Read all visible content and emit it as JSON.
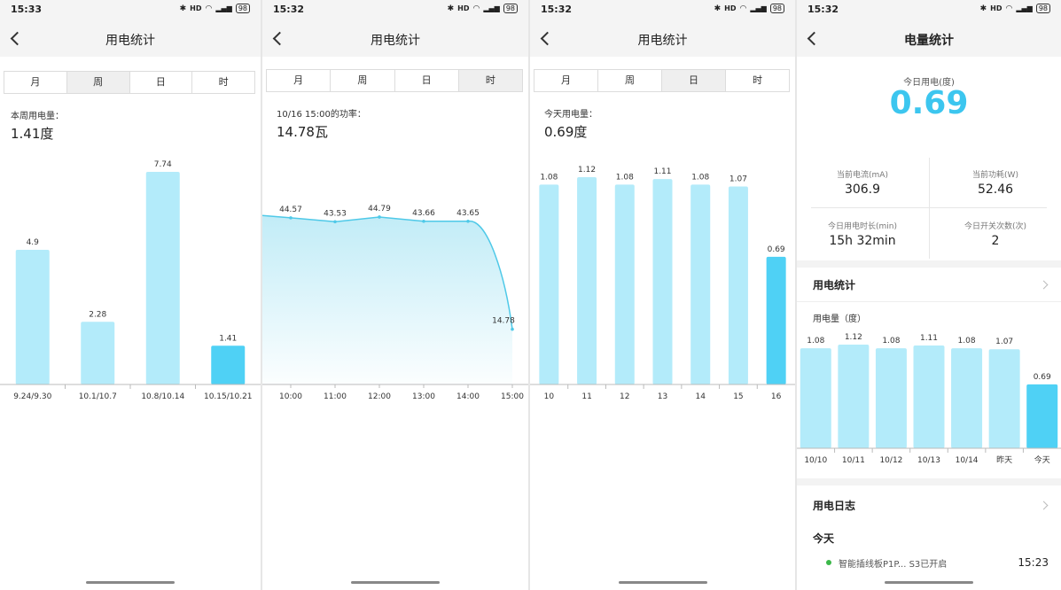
{
  "status": {
    "s1_time": "15:33",
    "s2_time": "15:32",
    "s3_time": "15:32",
    "s4_time": "15:32",
    "battery": "98",
    "icons": [
      "bluetooth-icon",
      "hd-icon",
      "wifi-icon",
      "signal-icon",
      "battery-icon"
    ]
  },
  "tabs": [
    "月",
    "周",
    "日",
    "时"
  ],
  "colors": {
    "bar": "#b3ebfa",
    "bar_active": "#4fd1f5",
    "line": "#4fc9e8",
    "accent": "#3cc6ef",
    "dot_on": "#3cb84a"
  },
  "screen1": {
    "title": "用电统计",
    "active_tab": 1,
    "summary_label": "本周用电量：",
    "summary_value": "1.41度",
    "chart_data": {
      "type": "bar",
      "categories": [
        "9.24/9.30",
        "10.1/10.7",
        "10.8/10.14",
        "10.15/10.21"
      ],
      "values": [
        4.9,
        2.28,
        7.74,
        1.41
      ],
      "labels": [
        "4.9",
        "2.28",
        "7.74",
        "1.41"
      ],
      "highlight_index": 3
    }
  },
  "screen2": {
    "title": "用电统计",
    "active_tab": 3,
    "summary_label": "10/16 15:00的功率：",
    "summary_value": "14.78瓦",
    "chart_data": {
      "type": "area",
      "categories": [
        "10:00",
        "11:00",
        "12:00",
        "13:00",
        "14:00",
        "15:00"
      ],
      "values": [
        44.57,
        43.53,
        44.79,
        43.66,
        43.65,
        14.78
      ],
      "labels": [
        "44.57",
        "43.53",
        "44.79",
        "43.66",
        "43.65",
        "14.78"
      ]
    }
  },
  "screen3": {
    "title": "用电统计",
    "active_tab": 2,
    "summary_label": "今天用电量：",
    "summary_value": "0.69度",
    "chart_data": {
      "type": "bar",
      "categories": [
        "10",
        "11",
        "12",
        "13",
        "14",
        "15",
        "16"
      ],
      "values": [
        1.08,
        1.12,
        1.08,
        1.11,
        1.08,
        1.07,
        0.69
      ],
      "labels": [
        "1.08",
        "1.12",
        "1.08",
        "1.11",
        "1.08",
        "1.07",
        "0.69"
      ],
      "highlight_index": 6
    }
  },
  "screen4": {
    "title": "电量统计",
    "today_label": "今日用电(度)",
    "today_value": "0.69",
    "stats": [
      {
        "label": "当前电流(mA)",
        "value": "306.9"
      },
      {
        "label": "当前功耗(W)",
        "value": "52.46"
      },
      {
        "label": "今日用电时长(min)",
        "value": "15h 32min"
      },
      {
        "label": "今日开关次数(次)",
        "value": "2"
      }
    ],
    "stats_section": "用电统计",
    "chart_label": "用电量（度）",
    "chart_data": {
      "type": "bar",
      "categories": [
        "10/10",
        "10/11",
        "10/12",
        "10/13",
        "10/14",
        "昨天",
        "今天"
      ],
      "values": [
        1.08,
        1.12,
        1.08,
        1.11,
        1.08,
        1.07,
        0.69
      ],
      "labels": [
        "1.08",
        "1.12",
        "1.08",
        "1.11",
        "1.08",
        "1.07",
        "0.69"
      ],
      "highlight_index": 6
    },
    "log_section": "用电日志",
    "log_day": "今天",
    "log_entry": {
      "text": "智能插线板P1P... S3已开启",
      "time": "15:23"
    }
  }
}
